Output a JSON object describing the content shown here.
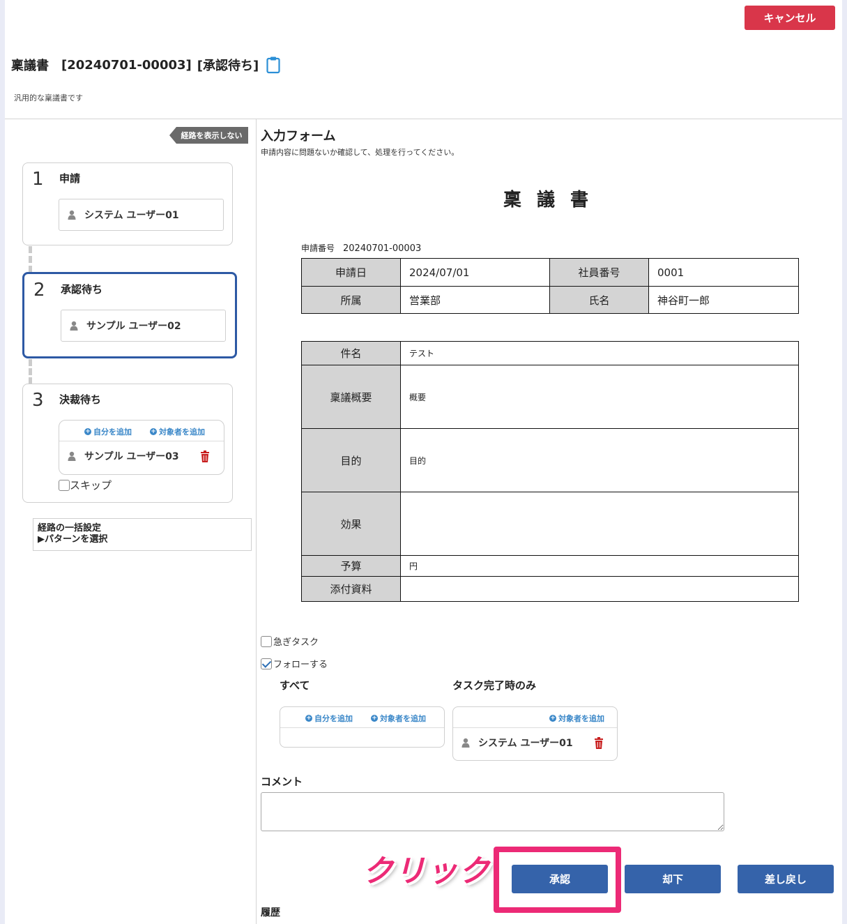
{
  "header": {
    "cancel_label": "キャンセル",
    "doc_type": "稟議書",
    "doc_number": "[20240701-00003]",
    "doc_status": "[承認待ち]",
    "description": "汎用的な稟議書です"
  },
  "route": {
    "hide_label": "経路を表示しない",
    "steps": [
      {
        "num": "1",
        "title": "申請",
        "users": [
          "システム ユーザー01"
        ]
      },
      {
        "num": "2",
        "title": "承認待ち",
        "users": [
          "サンプル ユーザー02"
        ]
      },
      {
        "num": "3",
        "title": "決裁待ち",
        "users": [
          "サンプル ユーザー03"
        ],
        "add_self": "自分を追加",
        "add_target": "対象者を追加",
        "skip_label": "スキップ"
      }
    ],
    "bulk_title": "経路の一括設定",
    "bulk_pattern": "▶パターンを選択"
  },
  "form": {
    "heading": "入力フォーム",
    "subtitle": "申請内容に問題ないか確認して、処理を行ってください。",
    "doc_name": "稟議書",
    "app_no_label": "申請番号",
    "app_no_value": "20240701-00003",
    "info": {
      "date_label": "申請日",
      "date_value": "2024/07/01",
      "emp_label": "社員番号",
      "emp_value": "0001",
      "dept_label": "所属",
      "dept_value": "営業部",
      "name_label": "氏名",
      "name_value": "神谷町一郎"
    },
    "detail": [
      {
        "label": "件名",
        "value": "テスト"
      },
      {
        "label": "稟議概要",
        "value": "概要"
      },
      {
        "label": "目的",
        "value": "目的"
      },
      {
        "label": "効果",
        "value": ""
      },
      {
        "label": "予算",
        "value": "円"
      },
      {
        "label": "添付資料",
        "value": ""
      }
    ]
  },
  "options": {
    "urgent_label": "急ぎタスク",
    "urgent_checked": false,
    "follow_label": "フォローする",
    "follow_checked": true,
    "all_label": "すべて",
    "complete_only_label": "タスク完了時のみ",
    "add_self": "自分を追加",
    "add_target": "対象者を追加",
    "complete_user": "システム ユーザー01"
  },
  "comment": {
    "label": "コメント",
    "value": ""
  },
  "actions": {
    "approve": "承認",
    "reject": "却下",
    "return": "差し戻し"
  },
  "annotation": {
    "click_label": "クリック",
    "color": "#ec2a76"
  },
  "history_label": "履歴"
}
